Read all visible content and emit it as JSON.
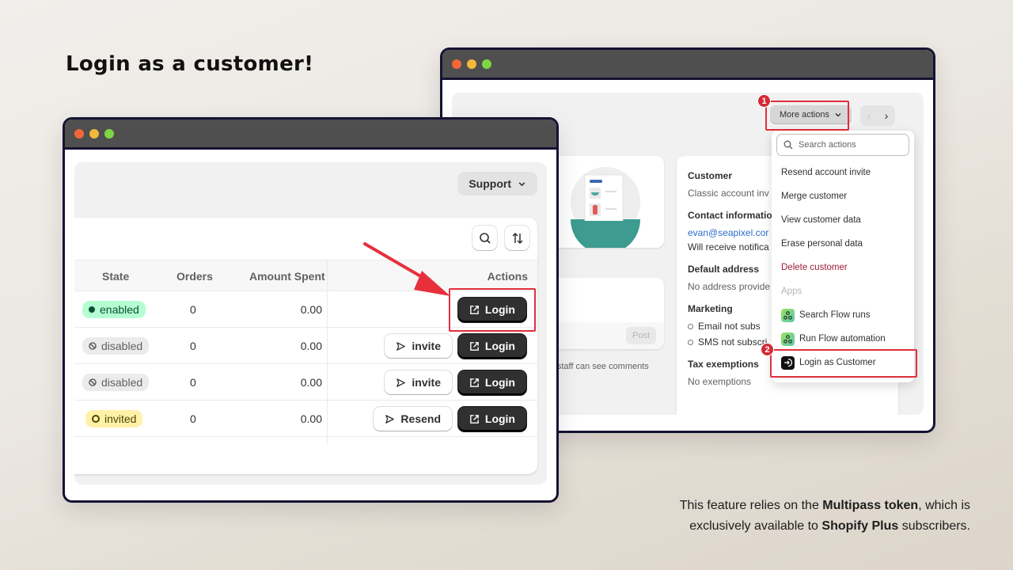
{
  "headline": "Login as a customer!",
  "footnote": {
    "line1_pre": "This feature relies on the ",
    "line1_bold": "Multipass token",
    "line1_post": ", which is",
    "line2_pre": "exclusively available to ",
    "line2_bold": "Shopify Plus",
    "line2_post": " subscribers."
  },
  "colors": {
    "highlight": "#e0303c",
    "badge": "#d42936",
    "enabled": "#b4fed2",
    "invited": "#fff1a8"
  },
  "back_window": {
    "more_actions_label": "More actions",
    "step1": "1",
    "step2": "2",
    "search_placeholder": "Search actions",
    "menu_items": [
      {
        "label": "Resend account invite"
      },
      {
        "label": "Merge customer"
      },
      {
        "label": "View customer data"
      },
      {
        "label": "Erase personal data"
      },
      {
        "label": "Delete customer"
      }
    ],
    "apps_section": "Apps",
    "app_items": [
      {
        "label": "Search Flow runs",
        "icon": "flow-icon"
      },
      {
        "label": "Run Flow automation",
        "icon": "flow-icon"
      },
      {
        "label": "Login as Customer",
        "icon": "login-enter-icon"
      }
    ],
    "post_label": "Post",
    "staff_note": "er staff can see comments",
    "customer": {
      "title": "Customer",
      "subtitle": "Classic account inv",
      "contact_title": "Contact informatio",
      "email": "evan@seapixel.cor",
      "notify": "Will receive notifica",
      "address_title": "Default address",
      "address": "No address provide",
      "marketing_title": "Marketing",
      "email_status": "Email not subs",
      "sms_status": "SMS not subscri",
      "tax_title": "Tax exemptions",
      "tax": "No exemptions"
    }
  },
  "front_window": {
    "support_label": "Support",
    "columns": [
      "State",
      "Orders",
      "Amount Spent",
      "Actions"
    ],
    "rows": [
      {
        "state": "enabled",
        "orders": "0",
        "amount": "0.00",
        "secondary": null,
        "login": "Login"
      },
      {
        "state": "disabled",
        "orders": "0",
        "amount": "0.00",
        "secondary": "invite",
        "login": "Login"
      },
      {
        "state": "disabled",
        "orders": "0",
        "amount": "0.00",
        "secondary": "invite",
        "login": "Login"
      },
      {
        "state": "invited",
        "orders": "0",
        "amount": "0.00",
        "secondary": "Resend",
        "login": "Login"
      }
    ]
  }
}
